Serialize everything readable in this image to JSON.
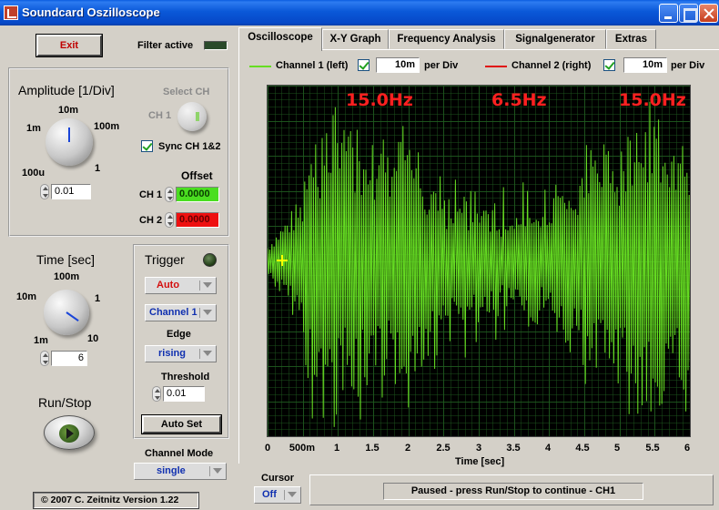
{
  "window": {
    "title": "Soundcard Oszilloscope"
  },
  "header": {
    "exit_label": "Exit",
    "filter_label": "Filter active"
  },
  "amplitude": {
    "title": "Amplitude [1/Div]",
    "scale": [
      "100u",
      "1m",
      "10m",
      "100m",
      "1"
    ],
    "value": "0.01",
    "select_ch_label": "Select CH",
    "ch1_label": "CH 1",
    "sync_label": "Sync CH 1&2",
    "offset_label": "Offset",
    "ch1_offset_label": "CH 1",
    "ch1_offset": "0.0000",
    "ch2_offset_label": "CH 2",
    "ch2_offset": "0.0000"
  },
  "time": {
    "title": "Time [sec]",
    "scale": [
      "1m",
      "10m",
      "100m",
      "1",
      "10"
    ],
    "value": "6"
  },
  "trigger": {
    "title": "Trigger",
    "mode": "Auto",
    "channel": "Channel 1",
    "edge_label": "Edge",
    "edge": "rising",
    "threshold_label": "Threshold",
    "threshold": "0.01",
    "autoset_label": "Auto Set"
  },
  "runstop": {
    "label": "Run/Stop"
  },
  "channel_mode": {
    "label": "Channel Mode",
    "value": "single"
  },
  "footer": {
    "copyright": "© 2007  C. Zeitnitz Version 1.22"
  },
  "tabs": [
    "Oscilloscope",
    "X-Y Graph",
    "Frequency Analysis",
    "Signalgenerator",
    "Extras"
  ],
  "channels": {
    "ch1_label": "Channel 1 (left)",
    "ch1_div": "10m",
    "ch2_label": "Channel 2 (right)",
    "ch2_div": "10m",
    "per_div": "per Div",
    "ch1_color": "#66dd22",
    "ch2_color": "#e01010"
  },
  "scope": {
    "readouts": [
      "15.0Hz",
      "6.5Hz",
      "15.0Hz"
    ],
    "x_ticks": [
      "0",
      "500m",
      "1",
      "1.5",
      "2",
      "2.5",
      "3",
      "3.5",
      "4",
      "4.5",
      "5",
      "5.5",
      "6"
    ],
    "x_label": "Time [sec]"
  },
  "cursor": {
    "label": "Cursor",
    "value": "Off"
  },
  "status": {
    "text": "Paused - press Run/Stop to continue - CH1"
  }
}
